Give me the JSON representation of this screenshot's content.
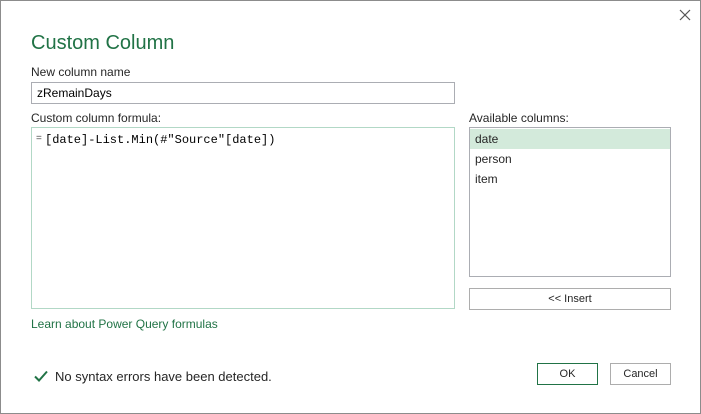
{
  "dialog": {
    "title": "Custom Column"
  },
  "name_field": {
    "label": "New column name",
    "value": "zRemainDays"
  },
  "formula": {
    "label": "Custom column formula:",
    "eq_sign": "=",
    "text": "[date]-List.Min(#\"Source\"[date])"
  },
  "available": {
    "label": "Available columns:",
    "items": [
      {
        "label": "date",
        "selected": true
      },
      {
        "label": "person",
        "selected": false
      },
      {
        "label": "item",
        "selected": false
      }
    ]
  },
  "buttons": {
    "insert": "<< Insert",
    "ok": "OK",
    "cancel": "Cancel"
  },
  "learn_link": "Learn about Power Query formulas",
  "status": {
    "text": "No syntax errors have been detected.",
    "icon": "checkmark-icon"
  },
  "colors": {
    "accent": "#217346",
    "selection": "#d3eadb"
  }
}
